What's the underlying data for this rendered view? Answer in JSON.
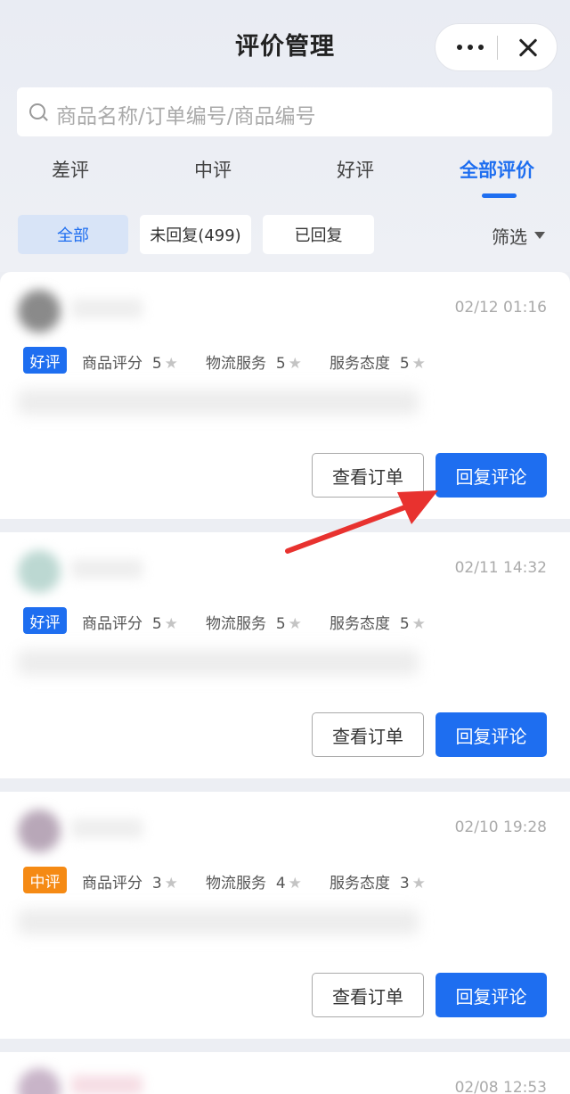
{
  "header": {
    "title": "评价管理"
  },
  "capsule": {
    "more_icon": "more-icon",
    "close_icon": "close-icon"
  },
  "search": {
    "placeholder": "商品名称/订单编号/商品编号"
  },
  "tabs": [
    {
      "label": "差评",
      "active": false
    },
    {
      "label": "中评",
      "active": false
    },
    {
      "label": "好评",
      "active": false
    },
    {
      "label": "全部评价",
      "active": true
    }
  ],
  "chips": [
    {
      "label": "全部",
      "active": true
    },
    {
      "label": "未回复(499)",
      "active": false
    },
    {
      "label": "已回复",
      "active": false
    }
  ],
  "filter": {
    "label": "筛选"
  },
  "ratings_labels": {
    "product": "商品评分",
    "logistics": "物流服务",
    "service": "服务态度"
  },
  "buttons": {
    "view_order": "查看订单",
    "reply": "回复评论"
  },
  "reviews": [
    {
      "time": "02/12 01:16",
      "badge": "好评",
      "badge_type": "good",
      "product": "5",
      "logistics": "5",
      "service": "5"
    },
    {
      "time": "02/11 14:32",
      "badge": "好评",
      "badge_type": "good",
      "product": "5",
      "logistics": "5",
      "service": "5"
    },
    {
      "time": "02/10 19:28",
      "badge": "中评",
      "badge_type": "mid",
      "product": "3",
      "logistics": "4",
      "service": "3"
    },
    {
      "time": "02/08 12:53"
    }
  ],
  "colors": {
    "accent": "#1e6ef0",
    "mid_badge": "#f58a14",
    "arrow": "#e8322f"
  }
}
